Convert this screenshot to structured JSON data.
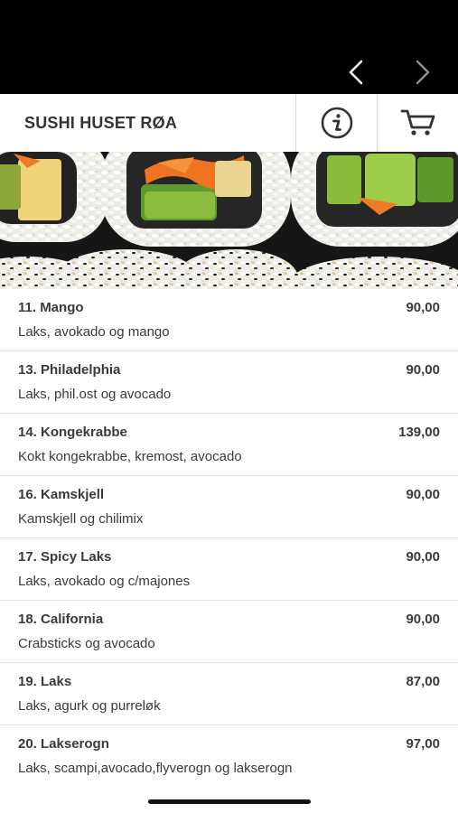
{
  "header": {
    "title": "SUSHI HUSET RØA"
  },
  "nav": {
    "back_icon": "chevron-left-icon",
    "forward_icon": "chevron-right-icon"
  },
  "icons": {
    "info": "info-circle-icon",
    "cart": "shopping-cart-icon"
  },
  "colors": {
    "topbar": "#000000",
    "text": "#3a3a3a",
    "divider": "#e3e3e3"
  },
  "menu": {
    "items": [
      {
        "name": "11. Mango",
        "price": "90,00",
        "description": "Laks, avokado og mango"
      },
      {
        "name": "13. Philadelphia",
        "price": "90,00",
        "description": "Laks, phil.ost og avocado"
      },
      {
        "name": "14. Kongekrabbe",
        "price": "139,00",
        "description": "Kokt kongekrabbe, kremost, avocado"
      },
      {
        "name": "16. Kamskjell",
        "price": "90,00",
        "description": "Kamskjell og chilimix"
      },
      {
        "name": "17. Spicy Laks",
        "price": "90,00",
        "description": "Laks, avokado og c/majones"
      },
      {
        "name": "18. California",
        "price": "90,00",
        "description": "Crabsticks og avocado"
      },
      {
        "name": "19. Laks",
        "price": "87,00",
        "description": "Laks, agurk og purreløk"
      },
      {
        "name": "20. Lakserogn",
        "price": "97,00",
        "description": "Laks, scampi,avocado,flyverogn og lakserogn"
      }
    ]
  }
}
